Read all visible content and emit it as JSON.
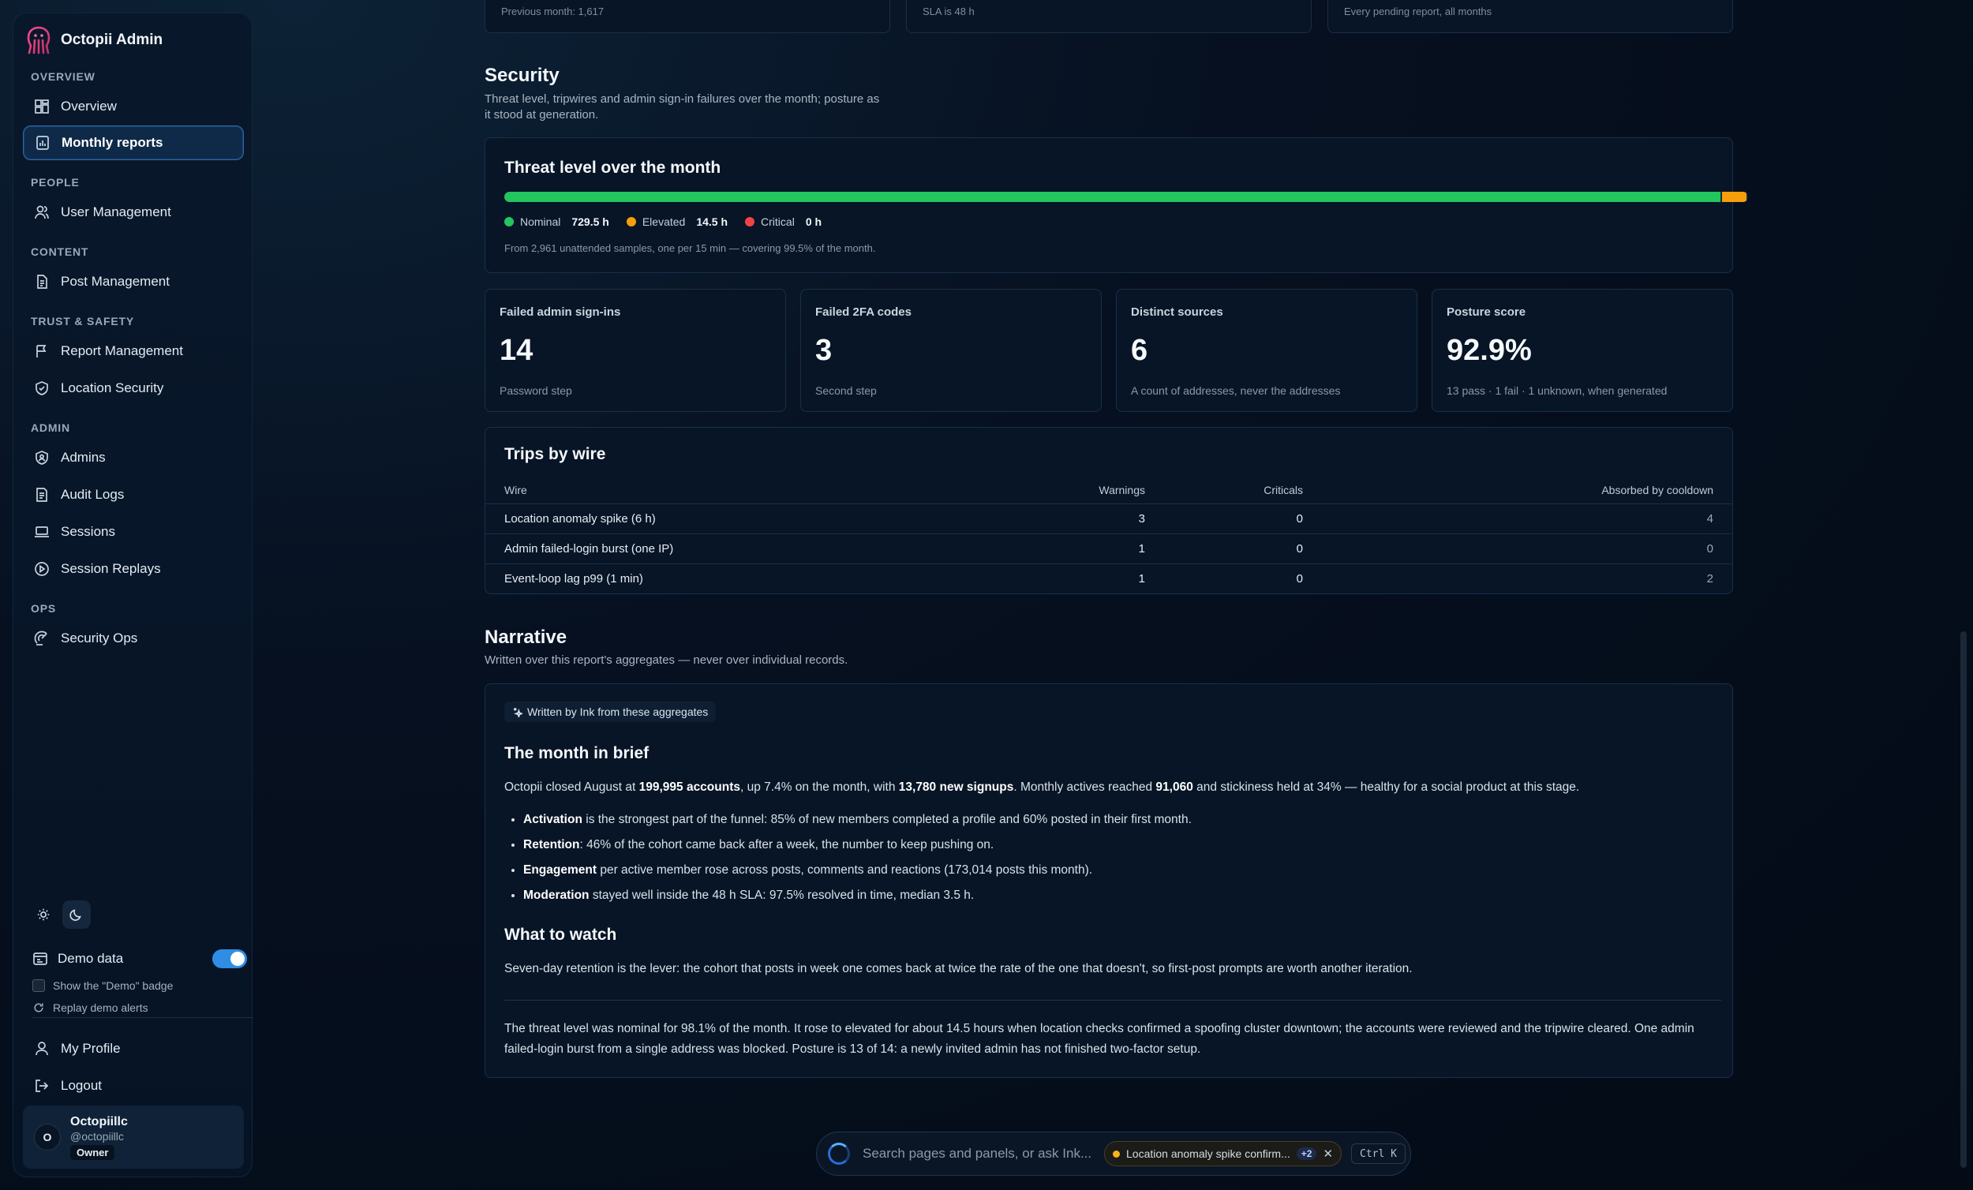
{
  "app": {
    "name": "Octopii Admin"
  },
  "sidebar": {
    "sections": {
      "overview": "OVERVIEW",
      "people": "PEOPLE",
      "content": "CONTENT",
      "trust": "TRUST & SAFETY",
      "admin": "ADMIN",
      "ops": "OPS"
    },
    "items": {
      "overview": "Overview",
      "monthly_reports": "Monthly reports",
      "user_management": "User Management",
      "post_management": "Post Management",
      "report_management": "Report Management",
      "location_security": "Location Security",
      "admins": "Admins",
      "audit_logs": "Audit Logs",
      "sessions": "Sessions",
      "session_replays": "Session Replays",
      "security_ops": "Security Ops"
    },
    "demo_label": "Demo data",
    "demo_enabled": true,
    "show_badge_label": "Show the \"Demo\" badge",
    "replay_label": "Replay demo alerts",
    "my_profile": "My Profile",
    "logout": "Logout",
    "user": {
      "initial": "O",
      "name": "Octopiillc",
      "handle": "@octopiillc",
      "role": "Owner"
    }
  },
  "top_cards": [
    "Previous month: 1,617",
    "SLA is 48 h",
    "Every pending report, all months"
  ],
  "security": {
    "title": "Security",
    "subtitle_1": "Threat level, tripwires and admin sign-in failures over the month; posture as",
    "subtitle_2": "it stood at generation.",
    "threat": {
      "title": "Threat level over the month",
      "segments": [
        {
          "name": "Nominal",
          "hours": 729.5,
          "label": "729.5 h",
          "color": "#22c55e"
        },
        {
          "name": "Elevated",
          "hours": 14.5,
          "label": "14.5 h",
          "color": "#f59e0b"
        },
        {
          "name": "Critical",
          "hours": 0,
          "label": "0 h",
          "color": "#ef4444"
        }
      ],
      "note": "From 2,961 unattended samples, one per 15 min — covering 99.5% of the month."
    },
    "stats": [
      {
        "label": "Failed admin sign-ins",
        "value": "14",
        "note": "Password step"
      },
      {
        "label": "Failed 2FA codes",
        "value": "3",
        "note": "Second step"
      },
      {
        "label": "Distinct sources",
        "value": "6",
        "note": "A count of addresses, never the addresses"
      },
      {
        "label": "Posture score",
        "value": "92.9%",
        "note": "13 pass · 1 fail · 1 unknown, when generated"
      }
    ],
    "trips": {
      "title": "Trips by wire",
      "headers": [
        "Wire",
        "Warnings",
        "Criticals",
        "Absorbed by cooldown"
      ],
      "rows": [
        [
          "Location anomaly spike (6 h)",
          "3",
          "0",
          "4"
        ],
        [
          "Admin failed-login burst (one IP)",
          "1",
          "0",
          "0"
        ],
        [
          "Event-loop lag p99 (1 min)",
          "1",
          "0",
          "2"
        ]
      ]
    }
  },
  "narrative": {
    "title": "Narrative",
    "subtitle": "Written over this report's aggregates — never over individual records.",
    "chip": "Written by Ink from these aggregates",
    "brief_title": "The month in brief",
    "brief": {
      "a": "Octopii closed August at ",
      "b": "199,995 accounts",
      "c": ", up 7.4% on the month, with ",
      "d": "13,780 new signups",
      "e": ". Monthly actives reached ",
      "f": "91,060",
      "g": " and stickiness held at 34% — healthy for a social product at this stage."
    },
    "bullets": [
      {
        "bold": "Activation",
        "text": " is the strongest part of the funnel: 85% of new members completed a profile and 60% posted in their first month."
      },
      {
        "bold": "Retention",
        "text": ": 46% of the cohort came back after a week, the number to keep pushing on."
      },
      {
        "bold": "Engagement",
        "text": " per active member rose across posts, comments and reactions (173,014 posts this month)."
      },
      {
        "bold": "Moderation",
        "text": " stayed well inside the 48 h SLA: 97.5% resolved in time, median 3.5 h."
      }
    ],
    "watch_title": "What to watch",
    "watch": "Seven-day retention is the lever: the cohort that posts in week one comes back at twice the rate of the one that doesn't, so first-post prompts are worth another iteration.",
    "threat_para_1": "The threat level was nominal for 98.1% of the month. It rose to elevated for about 14.5 hours when location checks confirmed a spoofing cluster downtown; the accounts were reviewed and the tripwire cleared. One admin",
    "threat_para_2": "failed-login burst from a single address was blocked. Posture is 13 of 14: a newly invited admin has not finished two-factor setup."
  },
  "command_bar": {
    "placeholder": "Search pages and panels, or ask Ink...",
    "alert": "Location anomaly spike confirm...",
    "alert_more": "+2",
    "shortcut": "Ctrl K"
  }
}
